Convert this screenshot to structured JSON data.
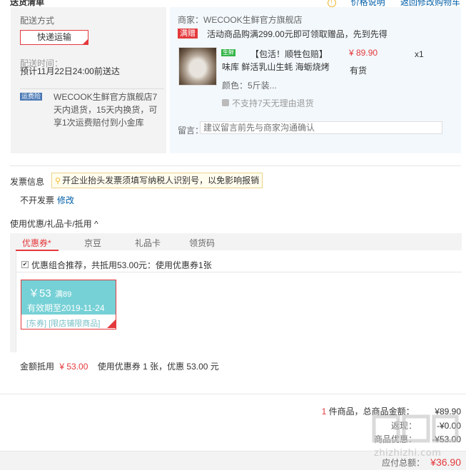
{
  "header": {
    "title": "送货清单",
    "links": [
      "价格说明",
      "返回修改购物车"
    ]
  },
  "shipping": {
    "method_label": "配送方式",
    "method_value": "快递运输",
    "time_label": "配送时间：",
    "time_value": "预计11月22日24:00前送达",
    "insurance_badge": "运费险",
    "insurance_text": "WECOOK生鲜官方旗舰店7天内退货，15天内换货，可享1次运费赔付到小金库"
  },
  "order": {
    "shop": "商家：WECOOK生鲜官方旗舰店",
    "gift_tag": "满赠",
    "gift_text": "活动商品购满299.00元即可领取赠品，先到先得",
    "product": {
      "fresh_tag": "生鲜",
      "title": "【包活！顺牲包赔】",
      "subtitle": "味库 鲜活乳山生蚝 海蛎烧烤",
      "price": "¥ 89.90",
      "qty": "x1",
      "stock": "有货",
      "color": "颜色：5斤装...",
      "no_return": "不支持7天无理由退货"
    },
    "message_label": "留言：",
    "message_placeholder": "建议留言前先与商家沟通确认"
  },
  "invoice": {
    "label": "发票信息",
    "tip": "开企业抬头发票须填写纳税人识别号，以免影响报销",
    "state": "不开发票",
    "modify": "修改"
  },
  "coupons": {
    "title": "使用优惠/礼品卡/抵用 ^",
    "tabs": [
      "优惠券*",
      "京豆",
      "礼品卡",
      "领货码"
    ],
    "combo_text": "优惠组合推荐，共抵用53.00元：使用优惠券1张",
    "card": {
      "amount": "￥53",
      "condition": "满89",
      "valid": "有效期至2019-11-24",
      "scope": "[东券] [限店铺限商品]"
    },
    "deduct_label": "金额抵用",
    "deduct_amount": "¥ 53.00",
    "deduct_detail": "使用优惠券 1 张，优惠 53.00 元"
  },
  "summary": {
    "count_num": "1",
    "count_unit": "件商品，总商品金额：",
    "total": "¥89.90",
    "rows": [
      {
        "label": "返现：",
        "value": "-¥0.00"
      },
      {
        "label": "商品优惠：",
        "value": "-¥53.00"
      }
    ],
    "payable_label": "应付总额：",
    "payable": "¥36.90"
  },
  "watermark": "zhizhizhi.com",
  "colors": {
    "accent": "#e4393c",
    "link": "#005ea7",
    "coupon": "#76d1d6"
  }
}
